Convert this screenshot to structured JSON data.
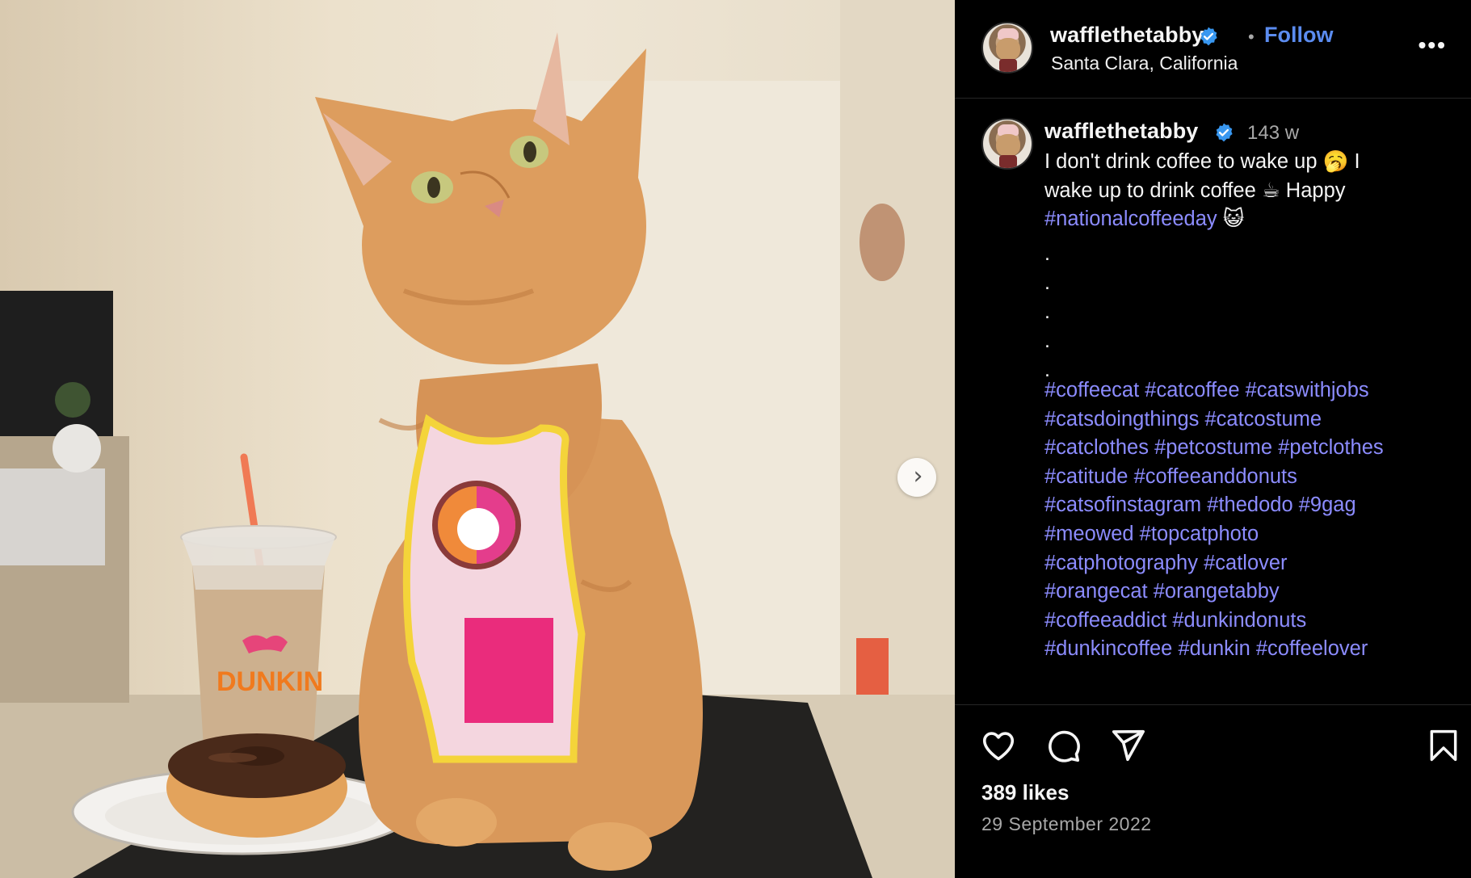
{
  "post": {
    "username": "wafflethetabby",
    "follow_label": "Follow",
    "separator": "•",
    "location": "Santa Clara, California",
    "more_label": "•••",
    "caption_username": "wafflethetabby",
    "time_ago": "143 w",
    "caption_line1": "I don't drink coffee to wake up 🥱 I",
    "caption_line2": "wake up to drink coffee ☕ Happy",
    "caption_tag1": "#nationalcoffeeday",
    "caption_tag_emoji": "😺",
    "dots": [
      ".",
      ".",
      ".",
      ".",
      "."
    ],
    "hashtags": [
      "#coffeecat",
      "#catcoffee",
      "#catswithjobs",
      "#catsdoingthings",
      "#catcostume",
      "#catclothes",
      "#petcostume",
      "#petclothes",
      "#catitude",
      "#coffeeanddonuts",
      "#catsofinstagram",
      "#thedodo",
      "#9gag",
      "#meowed",
      "#topcatphoto",
      "#catphotography",
      "#catlover",
      "#orangecat",
      "#orangetabby",
      "#coffeeaddict",
      "#dunkindonuts",
      "#dunkincoffee",
      "#dunkin",
      "#coffeelover"
    ],
    "likes": "389 likes",
    "date": "29 September 2022"
  },
  "photo": {
    "cup_brand": "DUNKIN",
    "next_label": "›"
  },
  "colors": {
    "link": "#8c8cff",
    "follow": "#5b8cf0",
    "verified": "#3897f0",
    "panel_bg": "#000000"
  },
  "icons": [
    "heart-icon",
    "comment-icon",
    "share-icon",
    "bookmark-icon",
    "verified-icon",
    "chevron-right-icon"
  ]
}
